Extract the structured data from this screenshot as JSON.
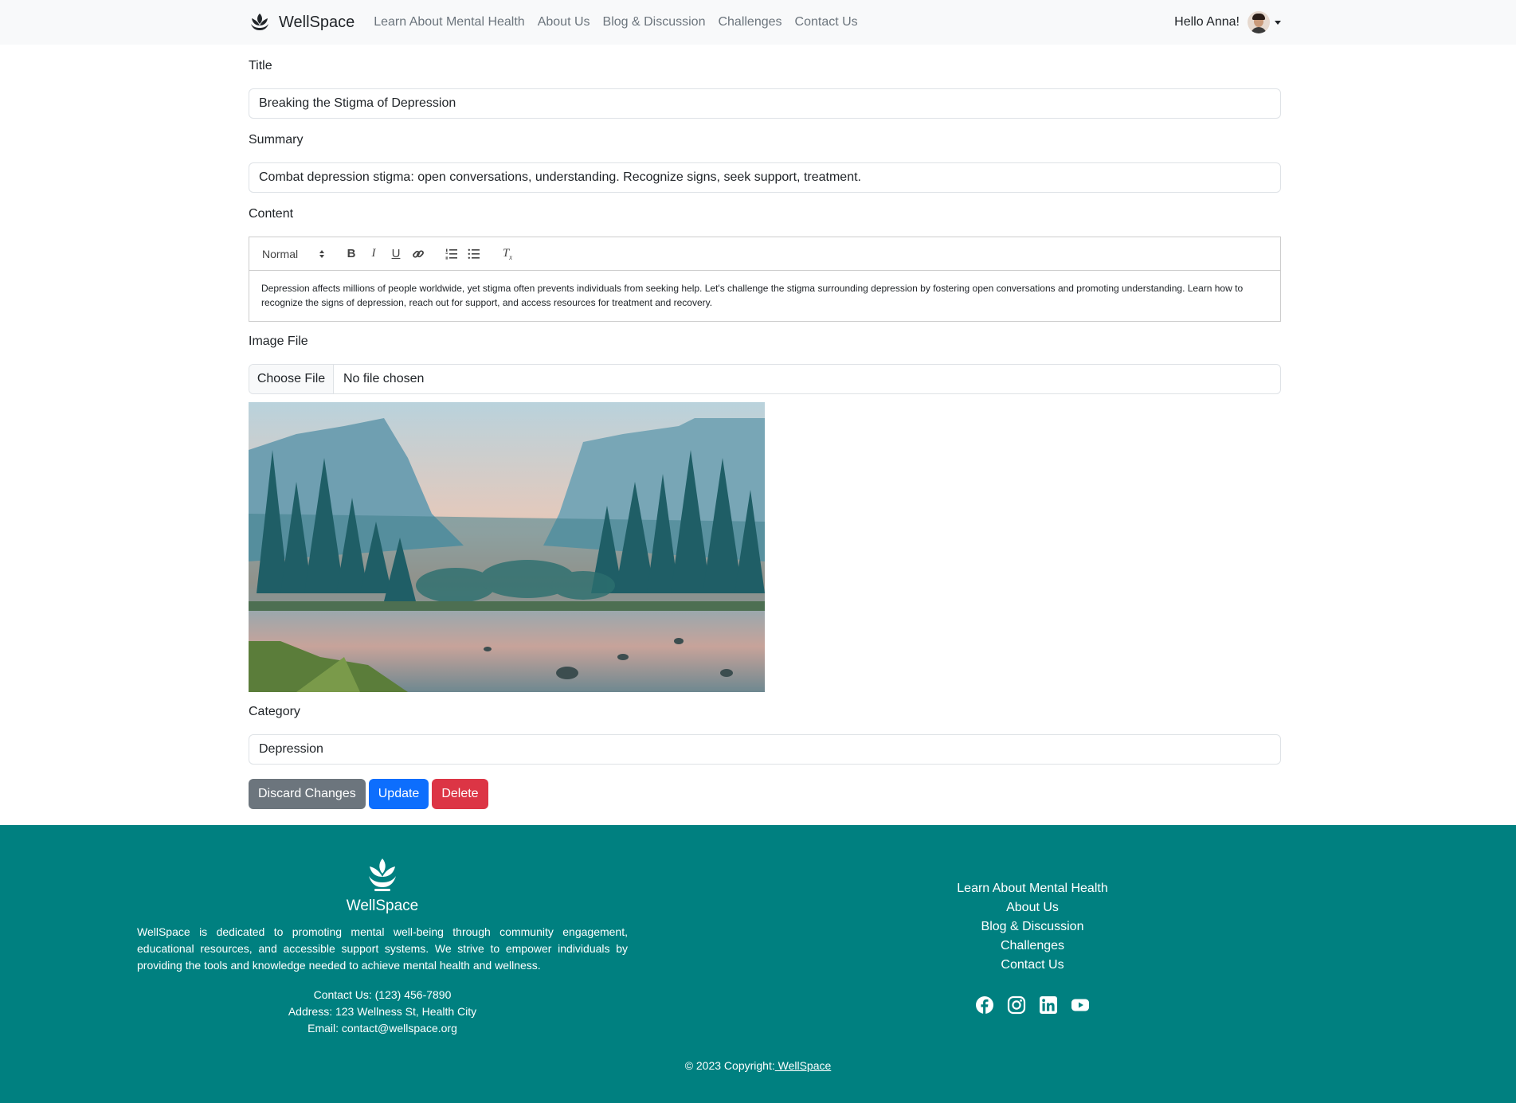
{
  "nav": {
    "brand": "WellSpace",
    "links": [
      "Learn About Mental Health",
      "About Us",
      "Blog & Discussion",
      "Challenges",
      "Contact Us"
    ],
    "greeting": "Hello Anna!"
  },
  "form": {
    "title_label": "Title",
    "title_value": "Breaking the Stigma of Depression",
    "summary_label": "Summary",
    "summary_value": "Combat depression stigma: open conversations, understanding. Recognize signs, seek support, treatment.",
    "content_label": "Content",
    "editor": {
      "format": "Normal",
      "text": "Depression affects millions of people worldwide, yet stigma often prevents individuals from seeking help. Let's challenge the stigma surrounding depression by fostering open conversations and promoting understanding. Learn how to recognize the signs of depression, reach out for support, and access resources for treatment and recovery."
    },
    "image_label": "Image File",
    "file_button": "Choose File",
    "file_status": "No file chosen",
    "category_label": "Category",
    "category_value": "Depression",
    "buttons": {
      "discard": "Discard Changes",
      "update": "Update",
      "delete": "Delete"
    }
  },
  "footer": {
    "brand": "WellSpace",
    "description": "WellSpace is dedicated to promoting mental well-being through community engagement, educational resources, and accessible support systems. We strive to empower individuals by providing the tools and knowledge needed to achieve mental health and wellness.",
    "contact_phone": "Contact Us: (123) 456-7890",
    "address": "Address: 123 Wellness St, Health City",
    "email": "Email: contact@wellspace.org",
    "links": [
      "Learn About Mental Health",
      "About Us",
      "Blog & Discussion",
      "Challenges",
      "Contact Us"
    ],
    "social": [
      "facebook-icon",
      "instagram-icon",
      "linkedin-icon",
      "youtube-icon"
    ],
    "copyright_prefix": "© 2023 Copyright:",
    "copyright_link": " WellSpace"
  },
  "colors": {
    "footer_bg": "#008080",
    "primary": "#0d6efd",
    "danger": "#dc3545",
    "secondary": "#6c757d"
  }
}
